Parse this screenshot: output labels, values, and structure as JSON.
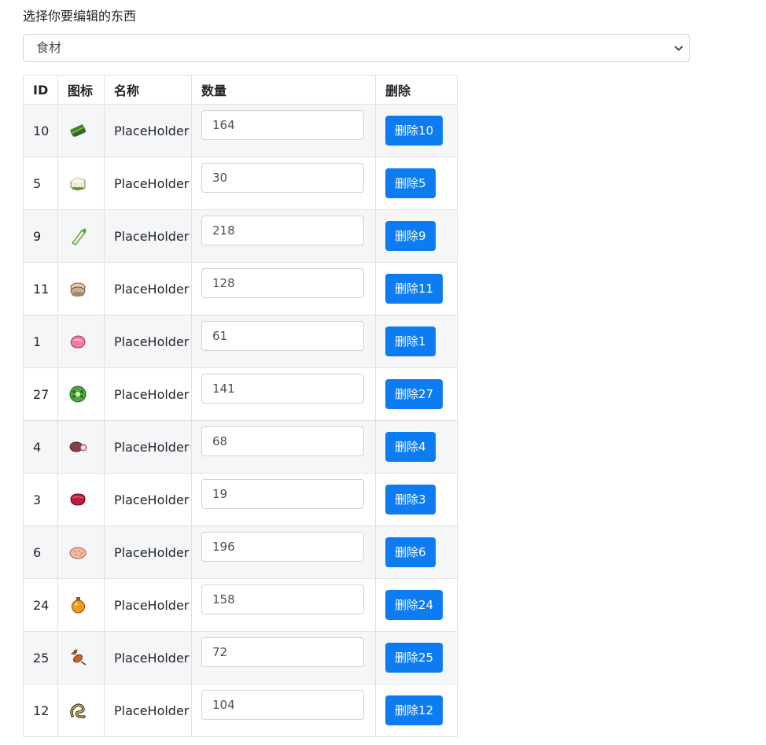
{
  "header": {
    "label": "选择你要编辑的东西"
  },
  "category_select": {
    "selected": "食材"
  },
  "table": {
    "headers": {
      "id": "ID",
      "icon": "图标",
      "name": "名称",
      "qty": "数量",
      "delete": "删除"
    },
    "rows": [
      {
        "id": "10",
        "icon": "green-vegetable-bundle-icon",
        "name": "PlaceHolder",
        "qty": "164",
        "delete_label": "删除10"
      },
      {
        "id": "5",
        "icon": "tofu-block-icon",
        "name": "PlaceHolder",
        "qty": "30",
        "delete_label": "删除5"
      },
      {
        "id": "9",
        "icon": "green-onion-icon",
        "name": "PlaceHolder",
        "qty": "218",
        "delete_label": "删除9"
      },
      {
        "id": "11",
        "icon": "fish-fillet-icon",
        "name": "PlaceHolder",
        "qty": "128",
        "delete_label": "删除11"
      },
      {
        "id": "1",
        "icon": "pink-meat-icon",
        "name": "PlaceHolder",
        "qty": "61",
        "delete_label": "删除1"
      },
      {
        "id": "27",
        "icon": "green-lotus-root-icon",
        "name": "PlaceHolder",
        "qty": "141",
        "delete_label": "删除27"
      },
      {
        "id": "4",
        "icon": "ham-leg-icon",
        "name": "PlaceHolder",
        "qty": "68",
        "delete_label": "删除4"
      },
      {
        "id": "3",
        "icon": "red-steak-icon",
        "name": "PlaceHolder",
        "qty": "19",
        "delete_label": "删除3"
      },
      {
        "id": "6",
        "icon": "dotted-bun-icon",
        "name": "PlaceHolder",
        "qty": "196",
        "delete_label": "删除6"
      },
      {
        "id": "24",
        "icon": "orange-potion-bottle-icon",
        "name": "PlaceHolder",
        "qty": "158",
        "delete_label": "删除24"
      },
      {
        "id": "25",
        "icon": "crayfish-icon",
        "name": "PlaceHolder",
        "qty": "72",
        "delete_label": "删除25"
      },
      {
        "id": "12",
        "icon": "eel-icon",
        "name": "PlaceHolder",
        "qty": "104",
        "delete_label": "删除12"
      }
    ]
  },
  "colors": {
    "primary_button": "#0d7cf2",
    "border": "#dee2e6",
    "stripe": "#f5f6f8"
  }
}
